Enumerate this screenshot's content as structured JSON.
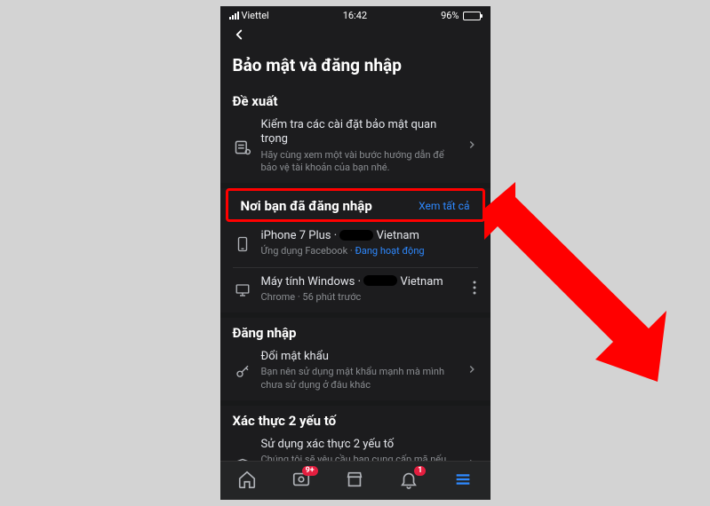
{
  "status": {
    "carrier": "Viettel",
    "time": "16:42",
    "battery_pct": "96%"
  },
  "page_title": "Bảo mật và đăng nhập",
  "recommended": {
    "heading": "Đề xuất",
    "item_title": "Kiểm tra các cài đặt bảo mật quan trọng",
    "item_sub": "Hãy cùng xem một vài bước hướng dẫn để bảo vệ tài khoản của bạn nhé."
  },
  "logged_in": {
    "heading": "Nơi bạn đã đăng nhập",
    "see_all": "Xem tất cả",
    "sessions": [
      {
        "device": "iPhone 7 Plus",
        "location": "Vietnam",
        "meta_prefix": "Ứng dụng Facebook · ",
        "status": "Đang hoạt động",
        "is_current": true
      },
      {
        "device": "Máy tính Windows",
        "location": "Vietnam",
        "meta": "Chrome · 56 phút trước",
        "is_current": false
      }
    ]
  },
  "login": {
    "heading": "Đăng nhập",
    "change_pw_title": "Đổi mật khẩu",
    "change_pw_sub": "Bạn nên sử dụng mật khẩu mạnh mà mình chưa sử dụng ở đâu khác"
  },
  "two_factor": {
    "heading": "Xác thực 2 yếu tố",
    "use_title": "Sử dụng xác thực 2 yếu tố",
    "use_sub": "Chúng tôi sẽ yêu cầu bạn cung cấp mã nếu phát hiện thấy lần đăng nhập từ thiết bị hoặc trình duyệt lạ."
  },
  "nav_badges": {
    "groups": "9+",
    "notifications": "1"
  }
}
